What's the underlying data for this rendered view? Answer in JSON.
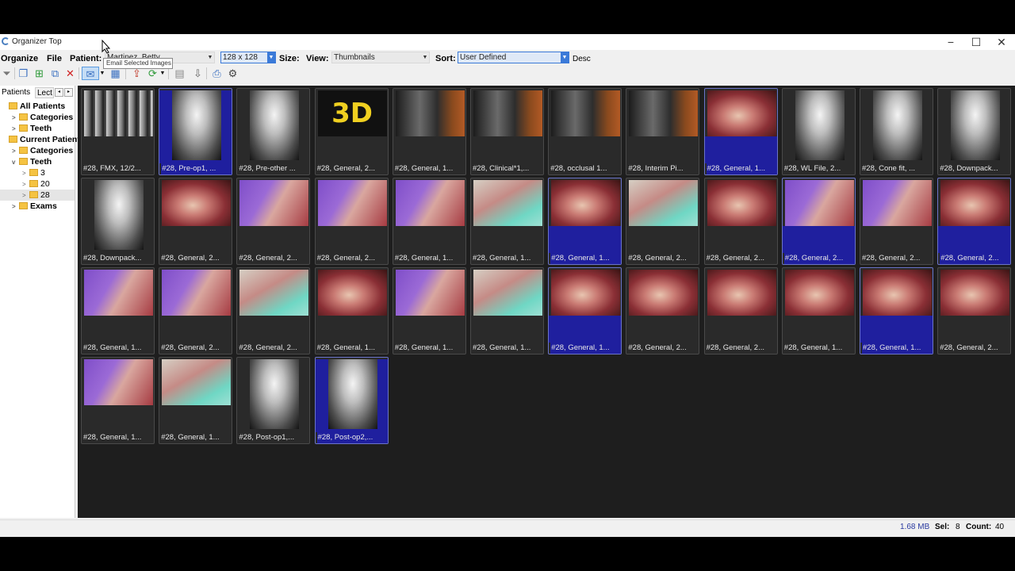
{
  "window": {
    "title": "Organizer Top",
    "controls": {
      "minimize": "−",
      "maximize": "☐",
      "close": "✕"
    }
  },
  "menubar": {
    "organize": "Organize",
    "file": "File",
    "patient_label": "Patient:",
    "patient_value": "Martinez, Betty",
    "thumb_size_value": "128 x 128",
    "size_label": "Size:",
    "view_label": "View:",
    "view_value": "Thumbnails",
    "sort_label": "Sort:",
    "sort_value": "User Defined",
    "desc_label": "Desc"
  },
  "toolbar": {
    "tooltip": "Email Selected Images",
    "icons": [
      "filter-icon",
      "copy-icon",
      "add-icon",
      "crop-icon",
      "delete-icon",
      "email-icon",
      "grid-icon",
      "export-icon",
      "refresh-icon",
      "database-icon",
      "import-icon",
      "print-icon",
      "settings-icon"
    ]
  },
  "sidebar": {
    "tabs": [
      "Patients",
      "Lect"
    ],
    "tab_nav": [
      "◂",
      "▸"
    ],
    "tree": [
      {
        "label": "All Patients",
        "indent": 0,
        "expander": ""
      },
      {
        "label": "Categories",
        "indent": 1,
        "expander": ">"
      },
      {
        "label": "Teeth",
        "indent": 1,
        "expander": ">"
      },
      {
        "label": "Current Patient",
        "indent": 0,
        "expander": ""
      },
      {
        "label": "Categories",
        "indent": 1,
        "expander": ">"
      },
      {
        "label": "Teeth",
        "indent": 1,
        "expander": "v"
      },
      {
        "label": "3",
        "indent": 2,
        "expander": ">"
      },
      {
        "label": "20",
        "indent": 2,
        "expander": ">"
      },
      {
        "label": "28",
        "indent": 2,
        "expander": ">"
      },
      {
        "label": "Exams",
        "indent": 1,
        "expander": ">"
      }
    ],
    "scroll": {
      "left": "<",
      "right": ">"
    }
  },
  "gallery": {
    "tiles": [
      {
        "caption": "#28, FMX, 12/2...",
        "type": "fmx",
        "selected": false
      },
      {
        "caption": "#28, Pre-op1, ...",
        "type": "xray",
        "selected": true
      },
      {
        "caption": "#28, Pre-other ...",
        "type": "xray",
        "selected": false
      },
      {
        "caption": "#28, General, 2...",
        "type": "logo3d",
        "selected": false
      },
      {
        "caption": "#28, General, 1...",
        "type": "cbct",
        "selected": false
      },
      {
        "caption": "#28, Clinical*1,...",
        "type": "cbct",
        "selected": false
      },
      {
        "caption": "#28, occlusal 1...",
        "type": "cbct",
        "selected": false
      },
      {
        "caption": "#28, Interim Pi...",
        "type": "cbct",
        "selected": false
      },
      {
        "caption": "#28, General, 1...",
        "type": "photo",
        "selected": true
      },
      {
        "caption": "#28, WL File, 2...",
        "type": "xray",
        "selected": false
      },
      {
        "caption": "#28, Cone fit, ...",
        "type": "xray",
        "selected": false
      },
      {
        "caption": "#28, Downpack...",
        "type": "xray",
        "selected": false
      },
      {
        "caption": "#28, Downpack...",
        "type": "xray",
        "selected": false
      },
      {
        "caption": "#28, General, 2...",
        "type": "photo",
        "selected": false
      },
      {
        "caption": "#28, General, 2...",
        "type": "glove",
        "selected": false
      },
      {
        "caption": "#28, General, 2...",
        "type": "glove",
        "selected": false
      },
      {
        "caption": "#28, General, 1...",
        "type": "glove",
        "selected": false
      },
      {
        "caption": "#28, General, 1...",
        "type": "mint",
        "selected": false
      },
      {
        "caption": "#28, General, 1...",
        "type": "photo",
        "selected": true
      },
      {
        "caption": "#28, General, 2...",
        "type": "mint",
        "selected": false
      },
      {
        "caption": "#28, General, 2...",
        "type": "photo",
        "selected": false
      },
      {
        "caption": "#28, General, 2...",
        "type": "glove",
        "selected": true
      },
      {
        "caption": "#28, General, 2...",
        "type": "glove",
        "selected": false
      },
      {
        "caption": "#28, General, 2...",
        "type": "photo",
        "selected": true
      },
      {
        "caption": "#28, General, 1...",
        "type": "glove",
        "selected": false
      },
      {
        "caption": "#28, General, 2...",
        "type": "glove",
        "selected": false
      },
      {
        "caption": "#28, General, 2...",
        "type": "mint",
        "selected": false
      },
      {
        "caption": "#28, General, 1...",
        "type": "photo",
        "selected": false
      },
      {
        "caption": "#28, General, 1...",
        "type": "glove",
        "selected": false
      },
      {
        "caption": "#28, General, 1...",
        "type": "mint",
        "selected": false
      },
      {
        "caption": "#28, General, 1...",
        "type": "photo",
        "selected": true
      },
      {
        "caption": "#28, General, 2...",
        "type": "photo",
        "selected": false
      },
      {
        "caption": "#28, General, 2...",
        "type": "photo",
        "selected": false
      },
      {
        "caption": "#28, General, 1...",
        "type": "photo",
        "selected": false
      },
      {
        "caption": "#28, General, 1...",
        "type": "photo",
        "selected": true
      },
      {
        "caption": "#28, General, 2...",
        "type": "photo",
        "selected": false
      },
      {
        "caption": "#28, General, 1...",
        "type": "glove",
        "selected": false
      },
      {
        "caption": "#28, General, 1...",
        "type": "mint",
        "selected": false
      },
      {
        "caption": "#28, Post-op1,...",
        "type": "xray",
        "selected": false
      },
      {
        "caption": "#28, Post-op2,...",
        "type": "xray",
        "selected": true
      }
    ]
  },
  "status": {
    "size": "1.68 MB",
    "sel_label": "Sel:",
    "sel_value": "8",
    "count_label": "Count:",
    "count_value": "40"
  },
  "colors": {
    "selection": "#1f1f9e",
    "gallery_bg": "#1e1e1e",
    "accent": "#3b7ad8"
  }
}
